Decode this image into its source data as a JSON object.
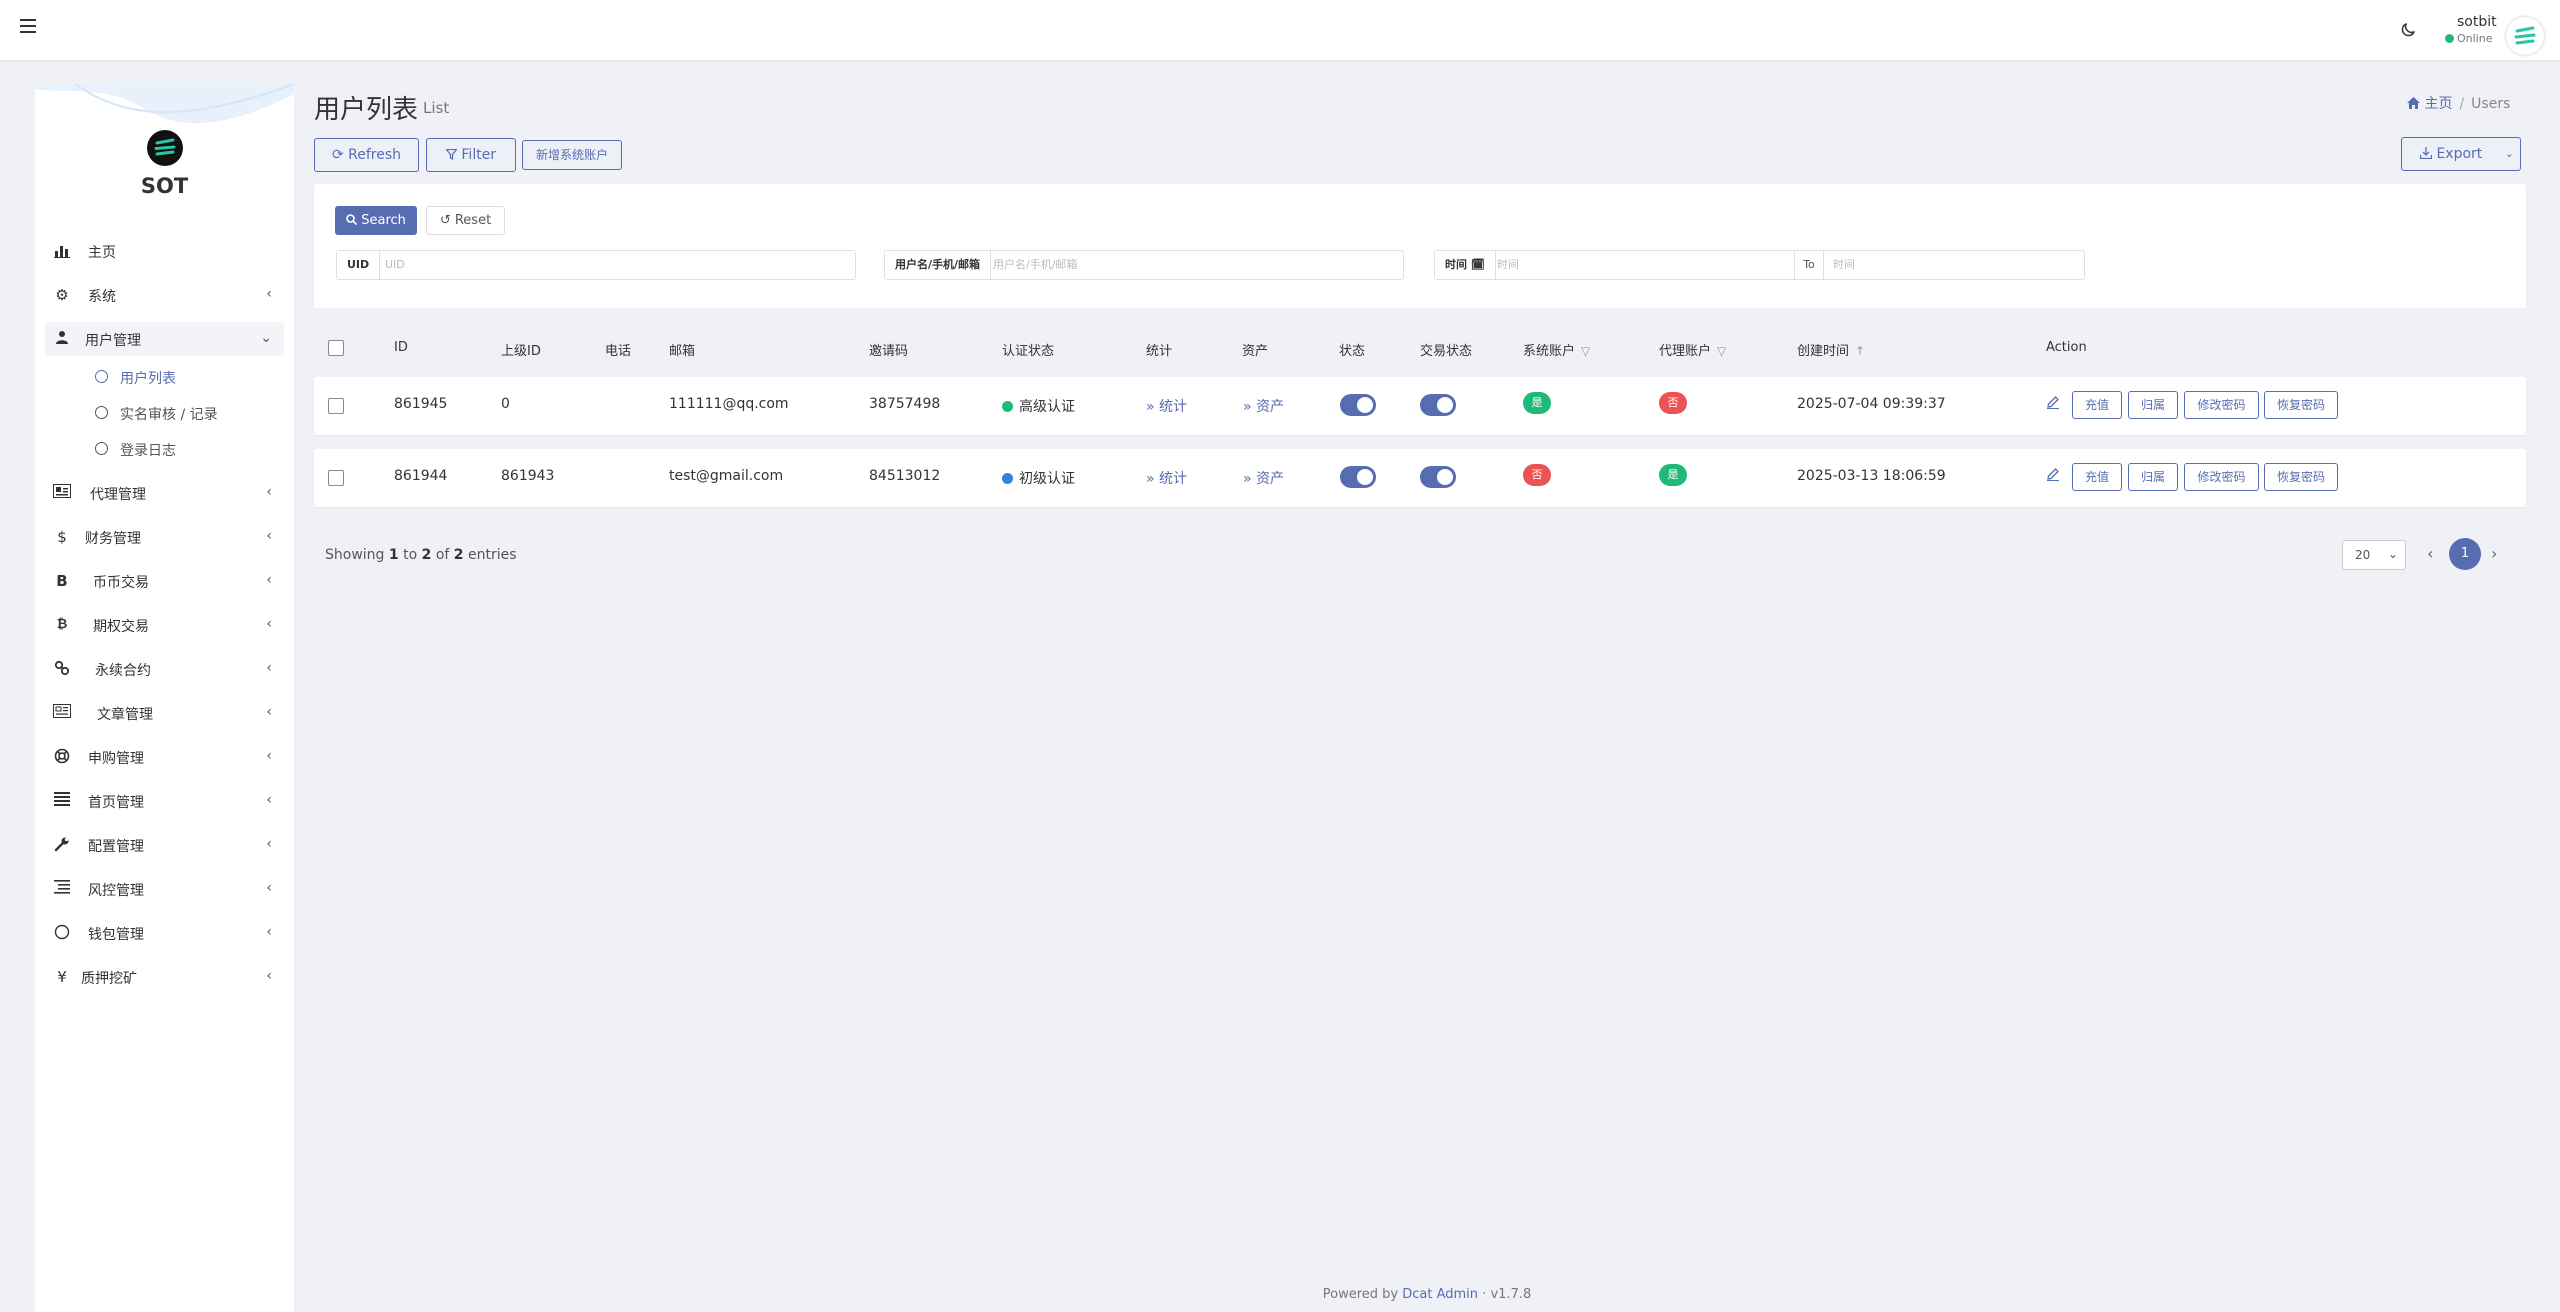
{
  "topbar": {
    "user_name": "sotbit",
    "user_status": "Online"
  },
  "sidebar": {
    "brand": "SOT",
    "menu": [
      {
        "label": "主页",
        "icon": "dashboard-icon"
      },
      {
        "label": "系统",
        "icon": "gear-icon"
      },
      {
        "label": "用户管理",
        "icon": "users-icon"
      },
      {
        "label": "代理管理",
        "icon": "id-card-icon"
      },
      {
        "label": "财务管理",
        "icon": "dollar-icon"
      },
      {
        "label": "币币交易",
        "icon": "bitcoin-b-icon"
      },
      {
        "label": "期权交易",
        "icon": "bitcoin-icon"
      },
      {
        "label": "永续合约",
        "icon": "link-icon"
      },
      {
        "label": "文章管理",
        "icon": "newspaper-icon"
      },
      {
        "label": "申购管理",
        "icon": "life-ring-icon"
      },
      {
        "label": "首页管理",
        "icon": "list-icon"
      },
      {
        "label": "配置管理",
        "icon": "wrench-icon"
      },
      {
        "label": "风控管理",
        "icon": "align-icon"
      },
      {
        "label": "钱包管理",
        "icon": "circle-icon"
      },
      {
        "label": "质押挖矿",
        "icon": "yen-icon"
      }
    ],
    "submenu": [
      {
        "label": "用户列表",
        "active": true
      },
      {
        "label": "实名审核 / 记录",
        "active": false
      },
      {
        "label": "登录日志",
        "active": false
      }
    ]
  },
  "header": {
    "title": "用户列表",
    "subtitle": "List",
    "breadcrumb_home": "主页",
    "breadcrumb_current": "Users"
  },
  "toolbar": {
    "refresh": "Refresh",
    "filter": "Filter",
    "new_system_account": "新增系统账户",
    "export": "Export"
  },
  "filter": {
    "search": "Search",
    "reset": "Reset",
    "uid_label": "UID",
    "uid_placeholder": "UID",
    "user_label": "用户名/手机/邮箱",
    "user_placeholder": "用户名/手机/邮箱",
    "time_label": "时间",
    "time_from_placeholder": "时间",
    "to_label": "To",
    "time_to_placeholder": "时间"
  },
  "table": {
    "columns": [
      "ID",
      "上级ID",
      "电话",
      "邮箱",
      "邀请码",
      "认证状态",
      "统计",
      "资产",
      "状态",
      "交易状态",
      "系统账户",
      "代理账户",
      "创建时间",
      "Action"
    ],
    "rows": [
      {
        "id": "861945",
        "parent_id": "0",
        "phone": "",
        "email": "111111@qq.com",
        "invite_code": "38757498",
        "verify_status": "高级认证",
        "verify_color": "#21b978",
        "stats": "统计",
        "assets": "资产",
        "status_on": true,
        "trade_status_on": true,
        "system_account": "是",
        "system_account_color": "green",
        "agent_account": "否",
        "agent_account_color": "red",
        "created_at": "2025-07-04 09:39:37"
      },
      {
        "id": "861944",
        "parent_id": "861943",
        "phone": "",
        "email": "test@gmail.com",
        "invite_code": "84513012",
        "verify_status": "初级认证",
        "verify_color": "#3085d6",
        "stats": "统计",
        "assets": "资产",
        "status_on": true,
        "trade_status_on": true,
        "system_account": "否",
        "system_account_color": "red",
        "agent_account": "是",
        "agent_account_color": "green",
        "created_at": "2025-03-13 18:06:59"
      }
    ],
    "actions": [
      "充值",
      "归属",
      "修改密码",
      "恢复密码"
    ]
  },
  "pagination": {
    "showing_prefix": "Showing",
    "from": "1",
    "to_word": "to",
    "to": "2",
    "of_word": "of",
    "total": "2",
    "entries": "entries",
    "per_page": "20",
    "current_page": "1"
  },
  "footer": {
    "powered_by": "Powered by",
    "product": "Dcat Admin",
    "dot": "·",
    "version": "v1.7.8"
  }
}
